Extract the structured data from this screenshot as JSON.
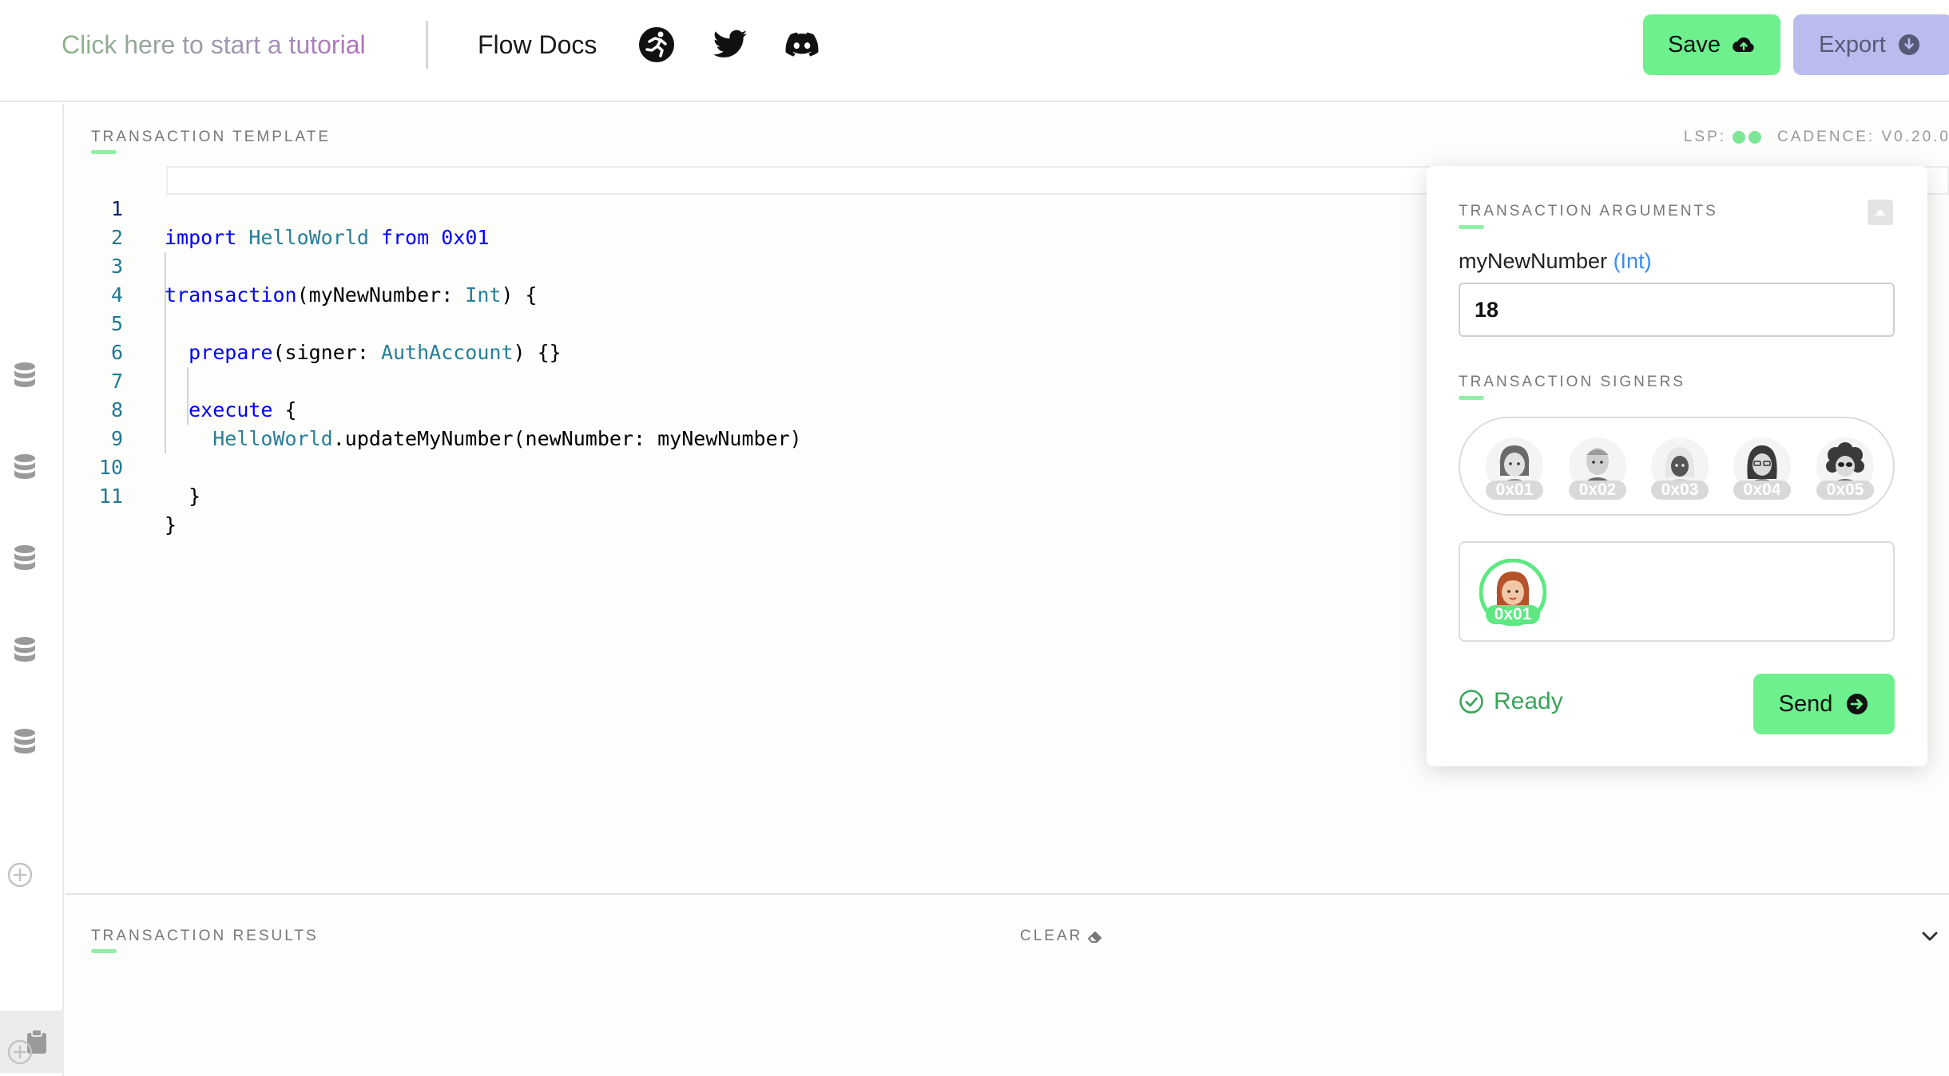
{
  "header": {
    "tutorial_link": "Click here to start a tutorial",
    "docs_link": "Flow Docs",
    "icons": [
      "flow-runner-icon",
      "twitter-icon",
      "discord-icon"
    ],
    "save_label": "Save",
    "export_label": "Export"
  },
  "colors": {
    "accent_green": "#6df08d",
    "export_purple": "#b9bced",
    "line_number": "#237893",
    "keyword": "#0000ff",
    "type": "#267f99",
    "ready_green": "#3aa35a",
    "arg_type_blue": "#3c8cf0"
  },
  "sidebar": {
    "items": [
      "database-icon",
      "database-icon",
      "database-icon",
      "database-icon",
      "database-icon",
      "add-icon",
      "clipboard-icon",
      "add-icon"
    ]
  },
  "editor": {
    "section_title": "TRANSACTION TEMPLATE",
    "lsp_label": "LSP:",
    "cadence_label": "CADENCE: V0.20.0",
    "line_numbers": [
      "1",
      "2",
      "3",
      "4",
      "5",
      "6",
      "7",
      "8",
      "9",
      "10",
      "11"
    ],
    "active_line": "1",
    "code": {
      "l1_kw_import": "import",
      "l1_name": "HelloWorld",
      "l1_kw_from": "from",
      "l1_addr": "0x01",
      "l3_kw": "transaction",
      "l3_param": "(myNewNumber: ",
      "l3_type": "Int",
      "l3_tail": ") {",
      "l5_kw": "prepare",
      "l5_param": "(signer: ",
      "l5_type": "AuthAccount",
      "l5_tail": ") {}",
      "l7_kw": "execute",
      "l7_tail": " {",
      "l8_obj": "HelloWorld",
      "l8_call": ".updateMyNumber(newNumber: myNewNumber)",
      "l10": "}",
      "l11": "}"
    }
  },
  "panel": {
    "args_title": "TRANSACTION ARGUMENTS",
    "arg_name": "myNewNumber",
    "arg_type": "(Int)",
    "arg_value": "18",
    "signers_title": "TRANSACTION SIGNERS",
    "accounts": [
      "0x01",
      "0x02",
      "0x03",
      "0x04",
      "0x05"
    ],
    "selected_signer": "0x01",
    "status": "Ready",
    "send_label": "Send"
  },
  "results": {
    "title": "TRANSACTION RESULTS",
    "clear_label": "CLEAR"
  }
}
